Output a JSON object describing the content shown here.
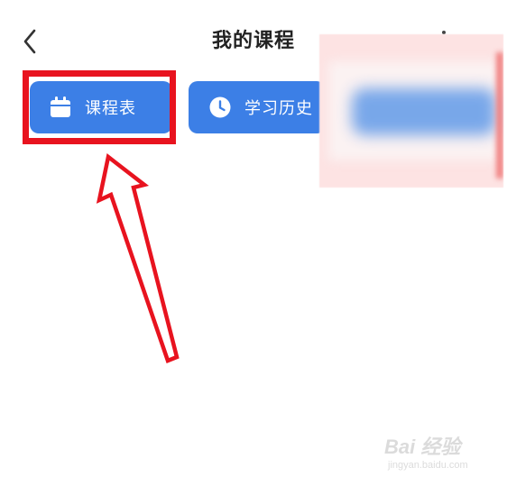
{
  "header": {
    "title": "我的课程"
  },
  "actions": {
    "schedule_label": "课程表",
    "history_label": "学习历史"
  },
  "watermark": {
    "logo_text": "Bai 经验",
    "url": "jingyan.baidu.com"
  },
  "colors": {
    "accent": "#3c7fe6",
    "annotation": "#e8131f",
    "title": "#222222"
  },
  "icons": {
    "back": "chevron-left-icon",
    "schedule": "calendar-icon",
    "history": "clock-icon"
  }
}
